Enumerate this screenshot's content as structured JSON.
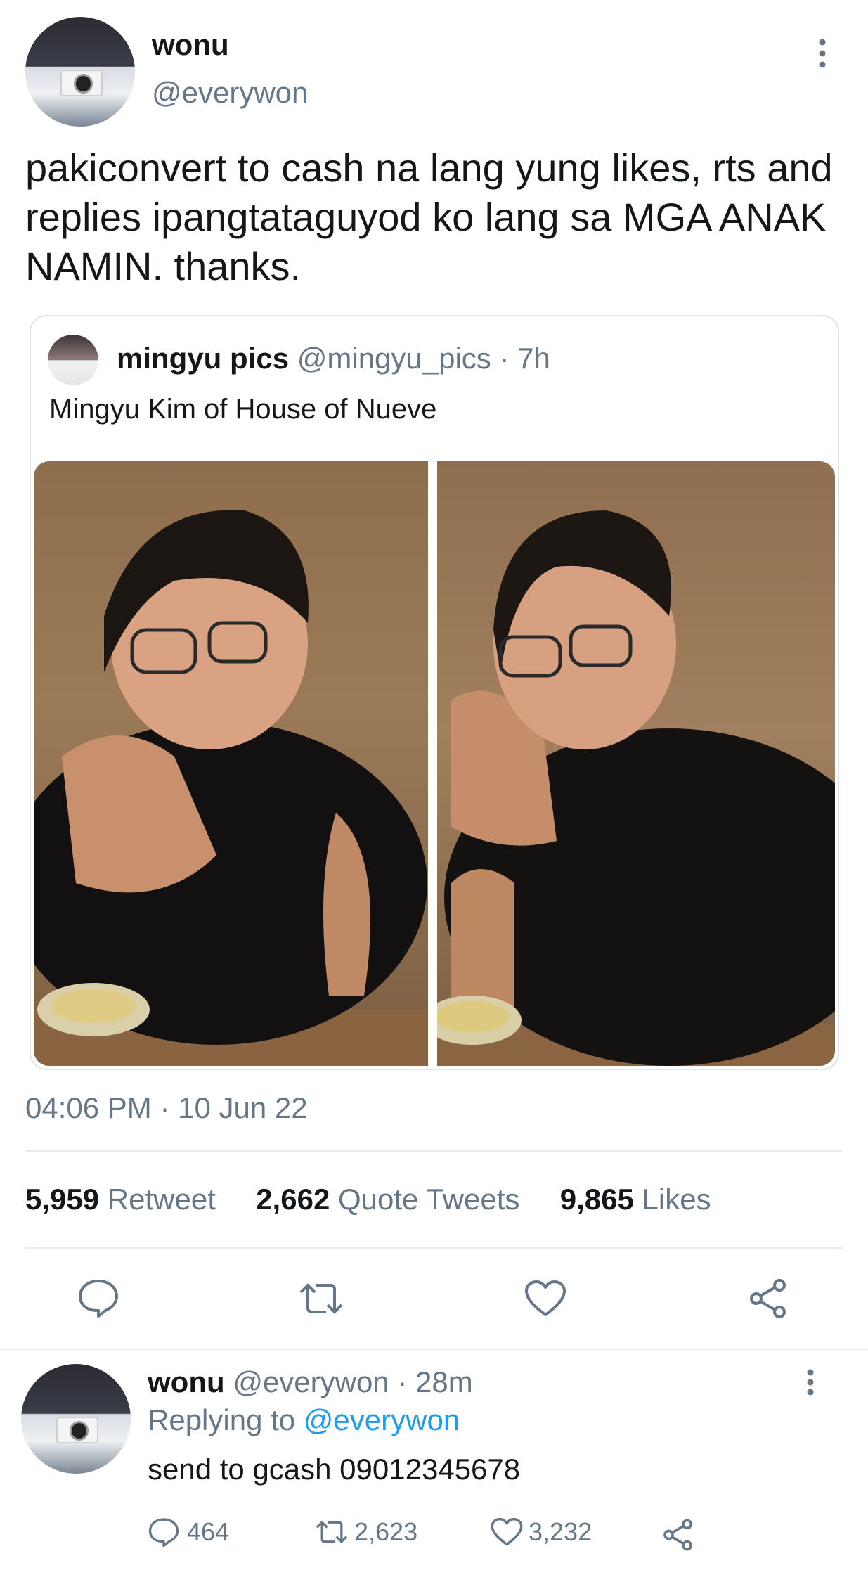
{
  "tweet": {
    "display_name": "wonu",
    "handle": "@everywon",
    "text": "pakiconvert to cash na lang yung likes, rts and replies ipangtataguyod ko lang sa MGA ANAK NAMIN. thanks.",
    "time": "04:06 PM · 10 Jun 22"
  },
  "quote": {
    "display_name": "mingyu pics",
    "handle": "@mingyu_pics",
    "age": "· 7h",
    "text": "Mingyu Kim of House of Nueve"
  },
  "stats": {
    "retweets": "5,959",
    "retweets_label": "Retweet",
    "quotes": "2,662",
    "quotes_label": "Quote Tweets",
    "likes": "9,865",
    "likes_label": "Likes"
  },
  "reply": {
    "display_name": "wonu",
    "handle": "@everywon",
    "age": "· 28m",
    "replying_prefix": "Replying to",
    "replying_to": "@everywon",
    "text": "send to gcash 09012345678",
    "replies": "464",
    "retweets": "2,623",
    "likes": "3,232"
  },
  "colors": {
    "accent": "#1d9bf0",
    "secondary_text": "#657786",
    "divider": "#e6ecf0"
  }
}
